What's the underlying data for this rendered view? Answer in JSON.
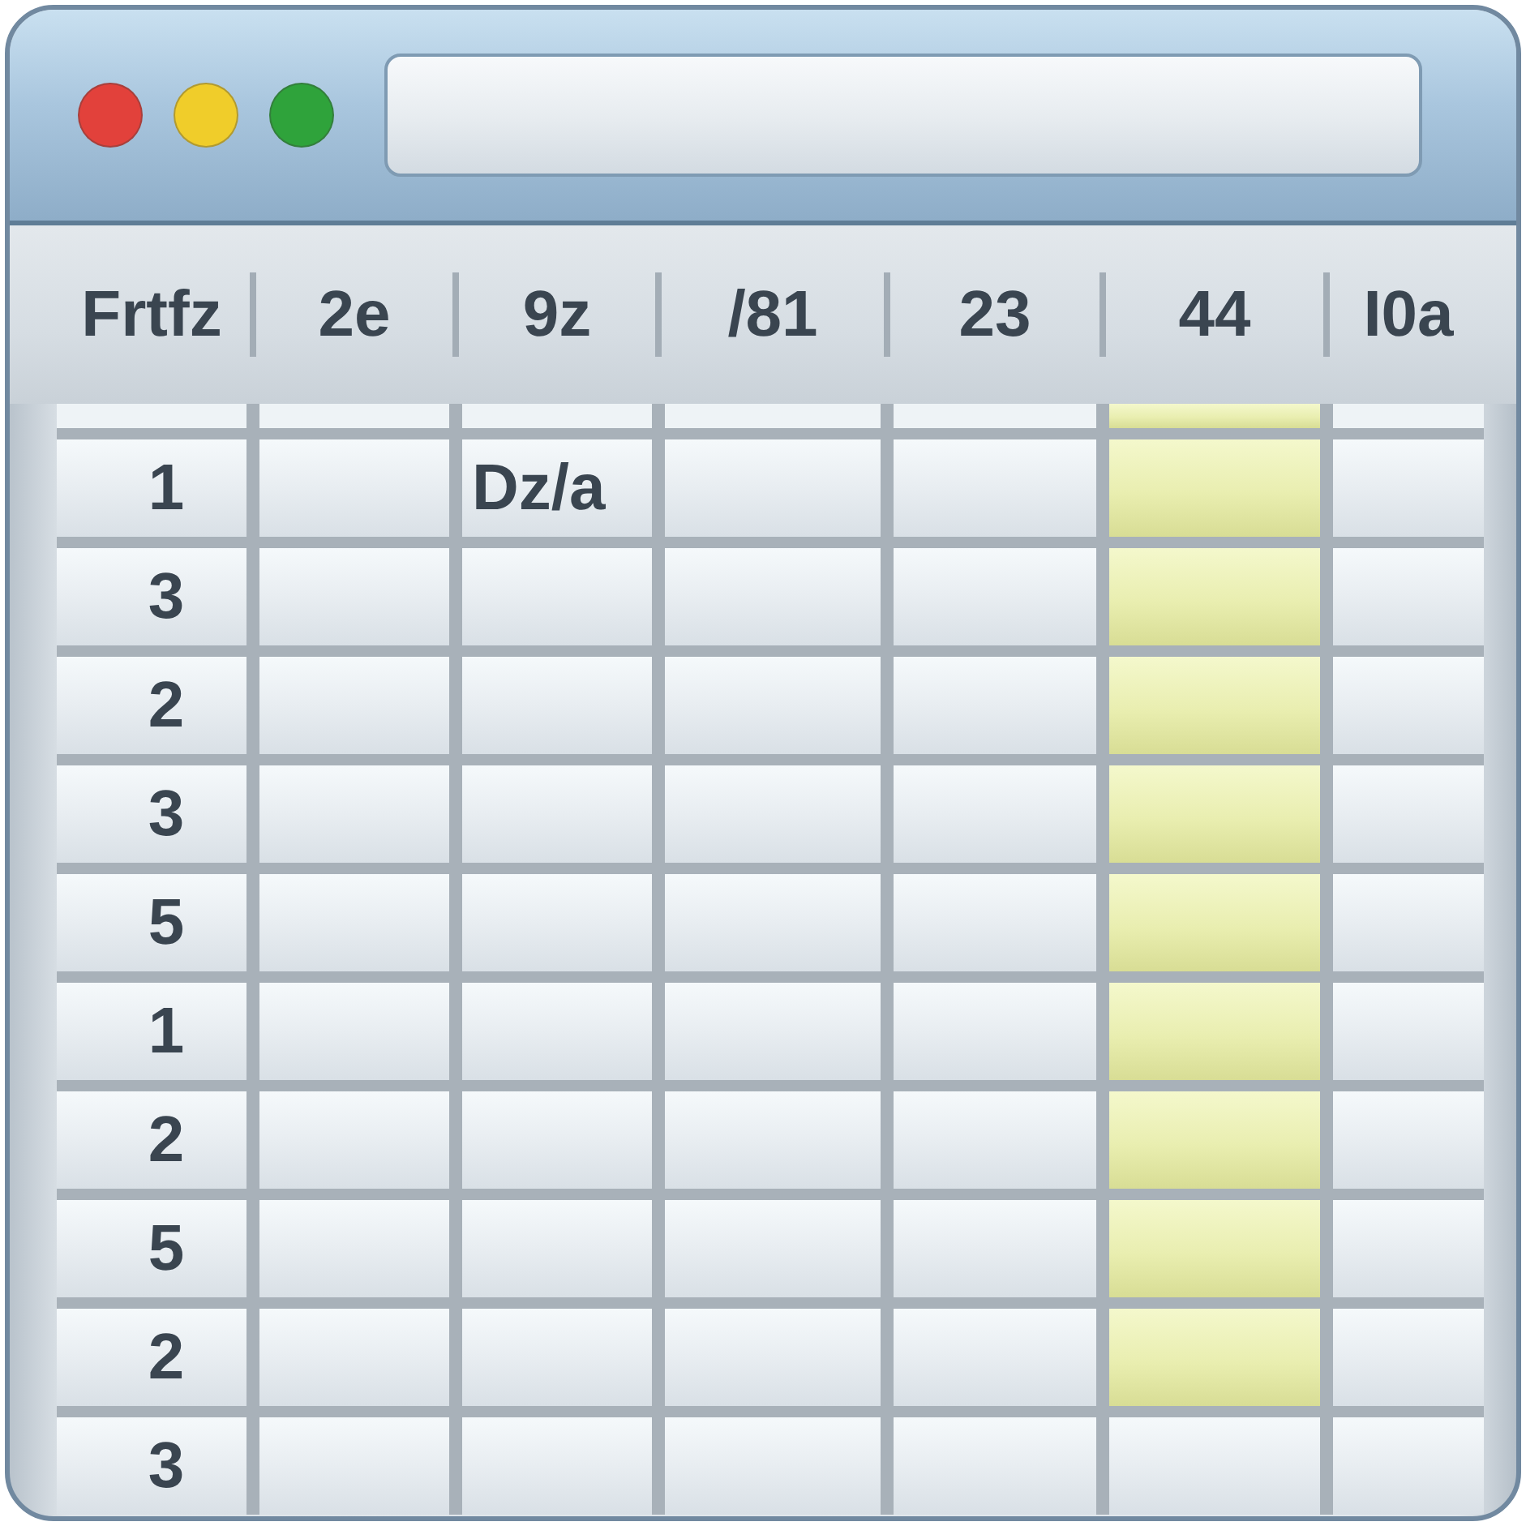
{
  "window": {
    "controls": [
      {
        "color": "#e2413b"
      },
      {
        "color": "#f0cd2a"
      },
      {
        "color": "#2fa33b"
      }
    ]
  },
  "table": {
    "columns": [
      "Frtfz",
      "2e",
      "9z",
      "/81",
      "23",
      "44",
      "I0a"
    ],
    "partial_row": {
      "cells": [
        {
          "highlighted": false
        },
        {
          "highlighted": false
        },
        {
          "highlighted": false
        },
        {
          "highlighted": false
        },
        {
          "highlighted": false
        },
        {
          "highlighted": true
        },
        {
          "highlighted": false
        }
      ]
    },
    "rows": [
      {
        "cells": [
          {
            "text": "1",
            "highlighted": false
          },
          {
            "highlighted": false
          },
          {
            "text": "Dz/a",
            "highlighted": false
          },
          {
            "highlighted": false
          },
          {
            "highlighted": false
          },
          {
            "highlighted": true
          },
          {
            "highlighted": false
          }
        ]
      },
      {
        "cells": [
          {
            "text": "3",
            "highlighted": false
          },
          {
            "highlighted": false
          },
          {
            "highlighted": false
          },
          {
            "highlighted": false
          },
          {
            "highlighted": false
          },
          {
            "highlighted": true
          },
          {
            "highlighted": false
          }
        ]
      },
      {
        "cells": [
          {
            "text": "2",
            "highlighted": false
          },
          {
            "highlighted": false
          },
          {
            "highlighted": false
          },
          {
            "highlighted": false
          },
          {
            "highlighted": false
          },
          {
            "highlighted": true
          },
          {
            "highlighted": false
          }
        ]
      },
      {
        "cells": [
          {
            "text": "3",
            "highlighted": false
          },
          {
            "highlighted": false
          },
          {
            "highlighted": false
          },
          {
            "highlighted": false
          },
          {
            "highlighted": false
          },
          {
            "highlighted": true
          },
          {
            "highlighted": false
          }
        ]
      },
      {
        "cells": [
          {
            "text": "5",
            "highlighted": false
          },
          {
            "highlighted": false
          },
          {
            "highlighted": false
          },
          {
            "highlighted": false
          },
          {
            "highlighted": false
          },
          {
            "highlighted": true
          },
          {
            "highlighted": false
          }
        ]
      },
      {
        "cells": [
          {
            "text": "1",
            "highlighted": false
          },
          {
            "highlighted": false
          },
          {
            "highlighted": false
          },
          {
            "highlighted": false
          },
          {
            "highlighted": false
          },
          {
            "highlighted": true
          },
          {
            "highlighted": false
          }
        ]
      },
      {
        "cells": [
          {
            "text": "2",
            "highlighted": false
          },
          {
            "highlighted": false
          },
          {
            "highlighted": false
          },
          {
            "highlighted": false
          },
          {
            "highlighted": false
          },
          {
            "highlighted": true
          },
          {
            "highlighted": false
          }
        ]
      },
      {
        "cells": [
          {
            "text": "5",
            "highlighted": false
          },
          {
            "highlighted": false
          },
          {
            "highlighted": false
          },
          {
            "highlighted": false
          },
          {
            "highlighted": false
          },
          {
            "highlighted": true
          },
          {
            "highlighted": false
          }
        ]
      },
      {
        "cells": [
          {
            "text": "2",
            "highlighted": false
          },
          {
            "highlighted": false
          },
          {
            "highlighted": false
          },
          {
            "highlighted": false
          },
          {
            "highlighted": false
          },
          {
            "highlighted": true
          },
          {
            "highlighted": false
          }
        ]
      },
      {
        "cells": [
          {
            "text": "3",
            "highlighted": false
          },
          {
            "highlighted": false
          },
          {
            "highlighted": false
          },
          {
            "highlighted": false
          },
          {
            "highlighted": false
          },
          {
            "highlighted": false
          },
          {
            "highlighted": false
          }
        ]
      }
    ]
  }
}
